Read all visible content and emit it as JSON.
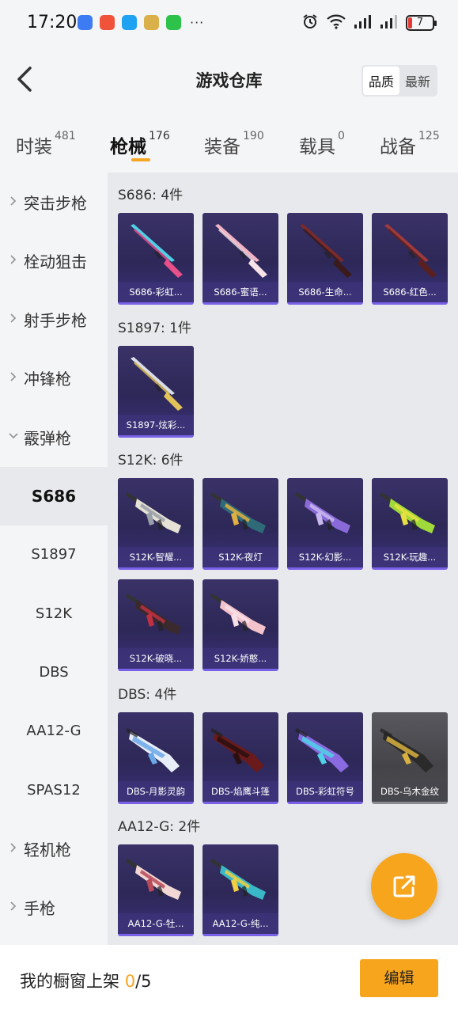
{
  "status_bar": {
    "time": "17:20",
    "more_indicator": "···",
    "battery_level": "7",
    "app_icons": [
      {
        "name": "app-icon-blue",
        "color": "#3d7bf5"
      },
      {
        "name": "app-icon-red",
        "color": "#f0523a"
      },
      {
        "name": "app-icon-chat",
        "color": "#1fa2f2"
      },
      {
        "name": "app-icon-yellow",
        "color": "#d9b04a"
      },
      {
        "name": "wechat-icon",
        "color": "#2dc24a"
      }
    ]
  },
  "header": {
    "title": "游戏仓库",
    "sort_options": [
      "品质",
      "最新"
    ],
    "sort_active": "品质"
  },
  "tabs": [
    {
      "label": "时装",
      "count": "481",
      "active": false
    },
    {
      "label": "枪械",
      "count": "176",
      "active": true
    },
    {
      "label": "装备",
      "count": "190",
      "active": false
    },
    {
      "label": "载具",
      "count": "0",
      "active": false
    },
    {
      "label": "战备",
      "count": "125",
      "active": false
    }
  ],
  "sidebar": {
    "items": [
      {
        "label": "突击步枪",
        "expanded": false
      },
      {
        "label": "栓动狙击",
        "expanded": false
      },
      {
        "label": "射手步枪",
        "expanded": false
      },
      {
        "label": "冲锋枪",
        "expanded": false
      },
      {
        "label": "霰弹枪",
        "expanded": true
      },
      {
        "label": "S686",
        "sub": true,
        "selected": true
      },
      {
        "label": "S1897",
        "sub": true
      },
      {
        "label": "S12K",
        "sub": true
      },
      {
        "label": "DBS",
        "sub": true
      },
      {
        "label": "AA12-G",
        "sub": true
      },
      {
        "label": "SPAS12",
        "sub": true
      },
      {
        "label": "轻机枪",
        "expanded": false
      },
      {
        "label": "手枪",
        "expanded": false
      }
    ]
  },
  "groups": [
    {
      "title": "S686: 4件",
      "items": [
        {
          "label": "S686-彩虹...",
          "accent": "#4fd1e8",
          "accent2": "#e8508a",
          "style": "shotgun"
        },
        {
          "label": "S686-蜜语...",
          "accent": "#f2b3c4",
          "accent2": "#f7e2e8",
          "style": "shotgun"
        },
        {
          "label": "S686-生命...",
          "accent": "#7a2a2a",
          "accent2": "#3a1a1a",
          "style": "shotgun"
        },
        {
          "label": "S686-红色...",
          "accent": "#a03a3a",
          "accent2": "#5a2020",
          "style": "shotgun"
        }
      ]
    },
    {
      "title": "S1897: 1件",
      "items": [
        {
          "label": "S1897-炫彩...",
          "accent": "#d8dde8",
          "accent2": "#e4c25a",
          "style": "pump"
        }
      ]
    },
    {
      "title": "S12K: 6件",
      "items": [
        {
          "label": "S12K-智耀...",
          "accent": "#e6e2d6",
          "accent2": "#9aa0a8",
          "style": "rifle"
        },
        {
          "label": "S12K-夜灯",
          "accent": "#2f6a78",
          "accent2": "#e0b040",
          "style": "rifle"
        },
        {
          "label": "S12K-幻影...",
          "accent": "#8a6ad8",
          "accent2": "#c8b8f0",
          "style": "rifle"
        },
        {
          "label": "S12K-玩趣...",
          "accent": "#9fd93a",
          "accent2": "#e8e040",
          "style": "rifle"
        },
        {
          "label": "S12K-破晓...",
          "accent": "#3a2a2e",
          "accent2": "#c03040",
          "style": "rifle"
        },
        {
          "label": "S12K-娇憨...",
          "accent": "#f3c3cc",
          "accent2": "#f8e0e6",
          "style": "rifle"
        }
      ]
    },
    {
      "title": "DBS: 4件",
      "items": [
        {
          "label": "DBS-月影灵韵",
          "accent": "#e8eef8",
          "accent2": "#6aa8e8",
          "style": "bullpup"
        },
        {
          "label": "DBS-焰鹰斗篷",
          "accent": "#6a1a1a",
          "accent2": "#2a1010",
          "style": "bullpup"
        },
        {
          "label": "DBS-彩虹符号",
          "accent": "#8a6ae0",
          "accent2": "#4fd1e8",
          "style": "bullpup"
        },
        {
          "label": "DBS-乌木金纹",
          "accent": "#2a2a2a",
          "accent2": "#d8b040",
          "style": "bullpup",
          "grey": true
        }
      ]
    },
    {
      "title": "AA12-G: 2件",
      "items": [
        {
          "label": "AA12-G-牡...",
          "accent": "#f2d8d4",
          "accent2": "#b84a5a",
          "style": "rifle"
        },
        {
          "label": "AA12-G-纯...",
          "accent": "#3ab8c8",
          "accent2": "#f0d040",
          "style": "rifle"
        }
      ]
    }
  ],
  "bottom_bar": {
    "shelf_label": "我的橱窗上架",
    "shelf_current": "0",
    "shelf_max": "/5",
    "edit_label": "编辑"
  },
  "colors": {
    "accent": "#f5a623",
    "card_bg": "#2d2857",
    "card_border": "#7a62e8"
  }
}
